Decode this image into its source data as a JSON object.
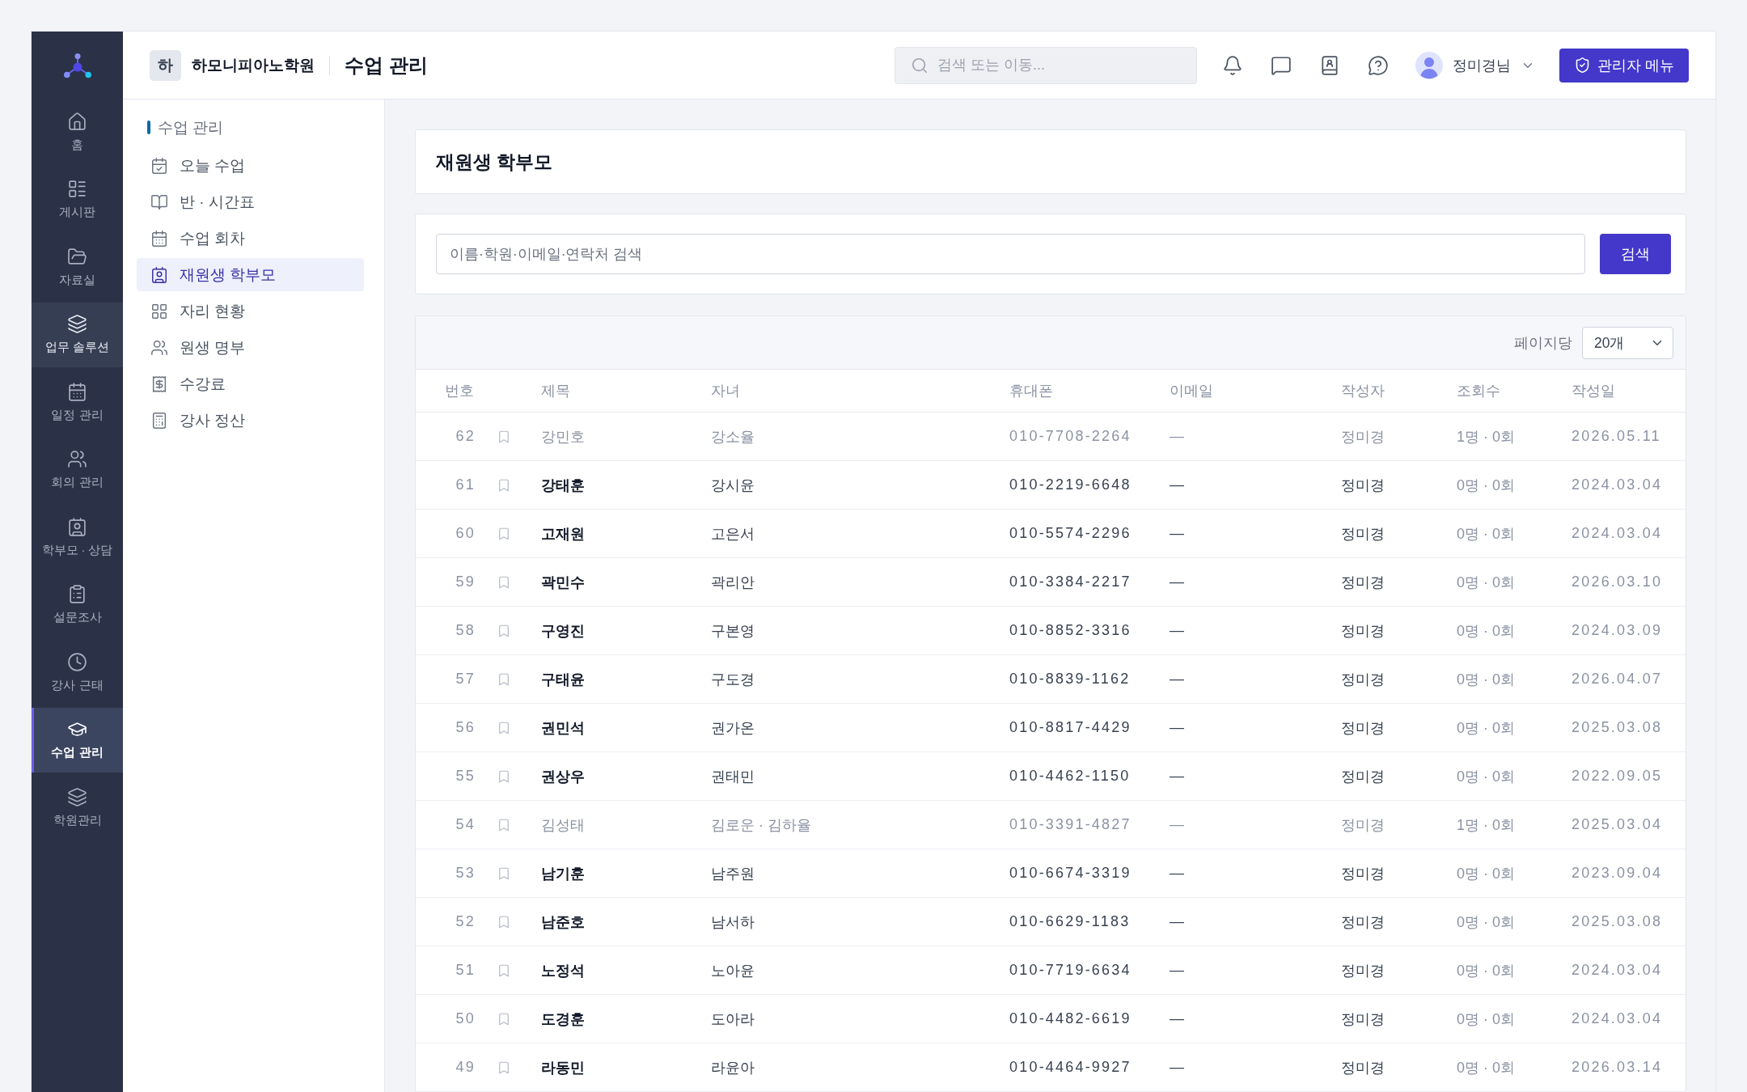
{
  "sidebar": {
    "items": [
      {
        "label": "홈",
        "selected": false,
        "hovered": false
      },
      {
        "label": "게시판",
        "selected": false,
        "hovered": false
      },
      {
        "label": "자료실",
        "selected": false,
        "hovered": false
      },
      {
        "label": "업무 솔루션",
        "selected": false,
        "hovered": true
      },
      {
        "label": "일정 관리",
        "selected": false,
        "hovered": false
      },
      {
        "label": "회의 관리",
        "selected": false,
        "hovered": false
      },
      {
        "label": "학부모 · 상담",
        "selected": false,
        "hovered": false
      },
      {
        "label": "설문조사",
        "selected": false,
        "hovered": false
      },
      {
        "label": "강사 근태",
        "selected": false,
        "hovered": false
      },
      {
        "label": "수업 관리",
        "selected": true,
        "hovered": false
      },
      {
        "label": "학원관리",
        "selected": false,
        "hovered": false
      }
    ]
  },
  "header": {
    "badge": "하",
    "academy": "하모니피아노학원",
    "title": "수업 관리",
    "search": {
      "placeholder": "검색 또는 이동..."
    },
    "user": "정미경님",
    "admin_button": "관리자 메뉴"
  },
  "submenu": {
    "title": "수업 관리",
    "items": [
      {
        "label": "오늘 수업",
        "selected": false
      },
      {
        "label": "반 · 시간표",
        "selected": false
      },
      {
        "label": "수업 회차",
        "selected": false
      },
      {
        "label": "재원생 학부모",
        "selected": true
      },
      {
        "label": "자리 현황",
        "selected": false
      },
      {
        "label": "원생 명부",
        "selected": false
      },
      {
        "label": "수강료",
        "selected": false
      },
      {
        "label": "강사 정산",
        "selected": false
      }
    ]
  },
  "page_title": "재원생 학부모",
  "search": {
    "placeholder": "이름·학원·이메일·연락처 검색",
    "button": "검색"
  },
  "table": {
    "per_page_label": "페이지당",
    "per_page": "20개",
    "columns": [
      "번호",
      "제목",
      "자녀",
      "휴대폰",
      "이메일",
      "작성자",
      "조회수",
      "작성일"
    ],
    "rows": [
      {
        "no": "62",
        "bookmarked": false,
        "title": "강민호",
        "child": "강소율",
        "phone": "010-7708-2264",
        "email": "—",
        "author": "정미경",
        "views": "1명 · 0회",
        "date": "2026.05.11",
        "muted": true
      },
      {
        "no": "61",
        "bookmarked": false,
        "title": "강태훈",
        "child": "강시윤",
        "phone": "010-2219-6648",
        "email": "—",
        "author": "정미경",
        "views": "0명 · 0회",
        "date": "2024.03.04",
        "muted": false
      },
      {
        "no": "60",
        "bookmarked": false,
        "title": "고재원",
        "child": "고은서",
        "phone": "010-5574-2296",
        "email": "—",
        "author": "정미경",
        "views": "0명 · 0회",
        "date": "2024.03.04",
        "muted": false
      },
      {
        "no": "59",
        "bookmarked": false,
        "title": "곽민수",
        "child": "곽리안",
        "phone": "010-3384-2217",
        "email": "—",
        "author": "정미경",
        "views": "0명 · 0회",
        "date": "2026.03.10",
        "muted": false
      },
      {
        "no": "58",
        "bookmarked": false,
        "title": "구영진",
        "child": "구본영",
        "phone": "010-8852-3316",
        "email": "—",
        "author": "정미경",
        "views": "0명 · 0회",
        "date": "2024.03.09",
        "muted": false
      },
      {
        "no": "57",
        "bookmarked": false,
        "title": "구태윤",
        "child": "구도경",
        "phone": "010-8839-1162",
        "email": "—",
        "author": "정미경",
        "views": "0명 · 0회",
        "date": "2026.04.07",
        "muted": false
      },
      {
        "no": "56",
        "bookmarked": false,
        "title": "권민석",
        "child": "권가온",
        "phone": "010-8817-4429",
        "email": "—",
        "author": "정미경",
        "views": "0명 · 0회",
        "date": "2025.03.08",
        "muted": false
      },
      {
        "no": "55",
        "bookmarked": false,
        "title": "권상우",
        "child": "권태민",
        "phone": "010-4462-1150",
        "email": "—",
        "author": "정미경",
        "views": "0명 · 0회",
        "date": "2022.09.05",
        "muted": false
      },
      {
        "no": "54",
        "bookmarked": false,
        "title": "김성태",
        "child": "김로운 · 김하율",
        "phone": "010-3391-4827",
        "email": "—",
        "author": "정미경",
        "views": "1명 · 0회",
        "date": "2025.03.04",
        "muted": true
      },
      {
        "no": "53",
        "bookmarked": false,
        "title": "남기훈",
        "child": "남주원",
        "phone": "010-6674-3319",
        "email": "—",
        "author": "정미경",
        "views": "0명 · 0회",
        "date": "2023.09.04",
        "muted": false
      },
      {
        "no": "52",
        "bookmarked": false,
        "title": "남준호",
        "child": "남서하",
        "phone": "010-6629-1183",
        "email": "—",
        "author": "정미경",
        "views": "0명 · 0회",
        "date": "2025.03.08",
        "muted": false
      },
      {
        "no": "51",
        "bookmarked": false,
        "title": "노정석",
        "child": "노아윤",
        "phone": "010-7719-6634",
        "email": "—",
        "author": "정미경",
        "views": "0명 · 0회",
        "date": "2024.03.04",
        "muted": false
      },
      {
        "no": "50",
        "bookmarked": false,
        "title": "도경훈",
        "child": "도아라",
        "phone": "010-4482-6619",
        "email": "—",
        "author": "정미경",
        "views": "0명 · 0회",
        "date": "2024.03.04",
        "muted": false
      },
      {
        "no": "49",
        "bookmarked": false,
        "title": "라동민",
        "child": "라윤아",
        "phone": "010-4464-9927",
        "email": "—",
        "author": "정미경",
        "views": "0명 · 0회",
        "date": "2026.03.14",
        "muted": false
      }
    ]
  }
}
